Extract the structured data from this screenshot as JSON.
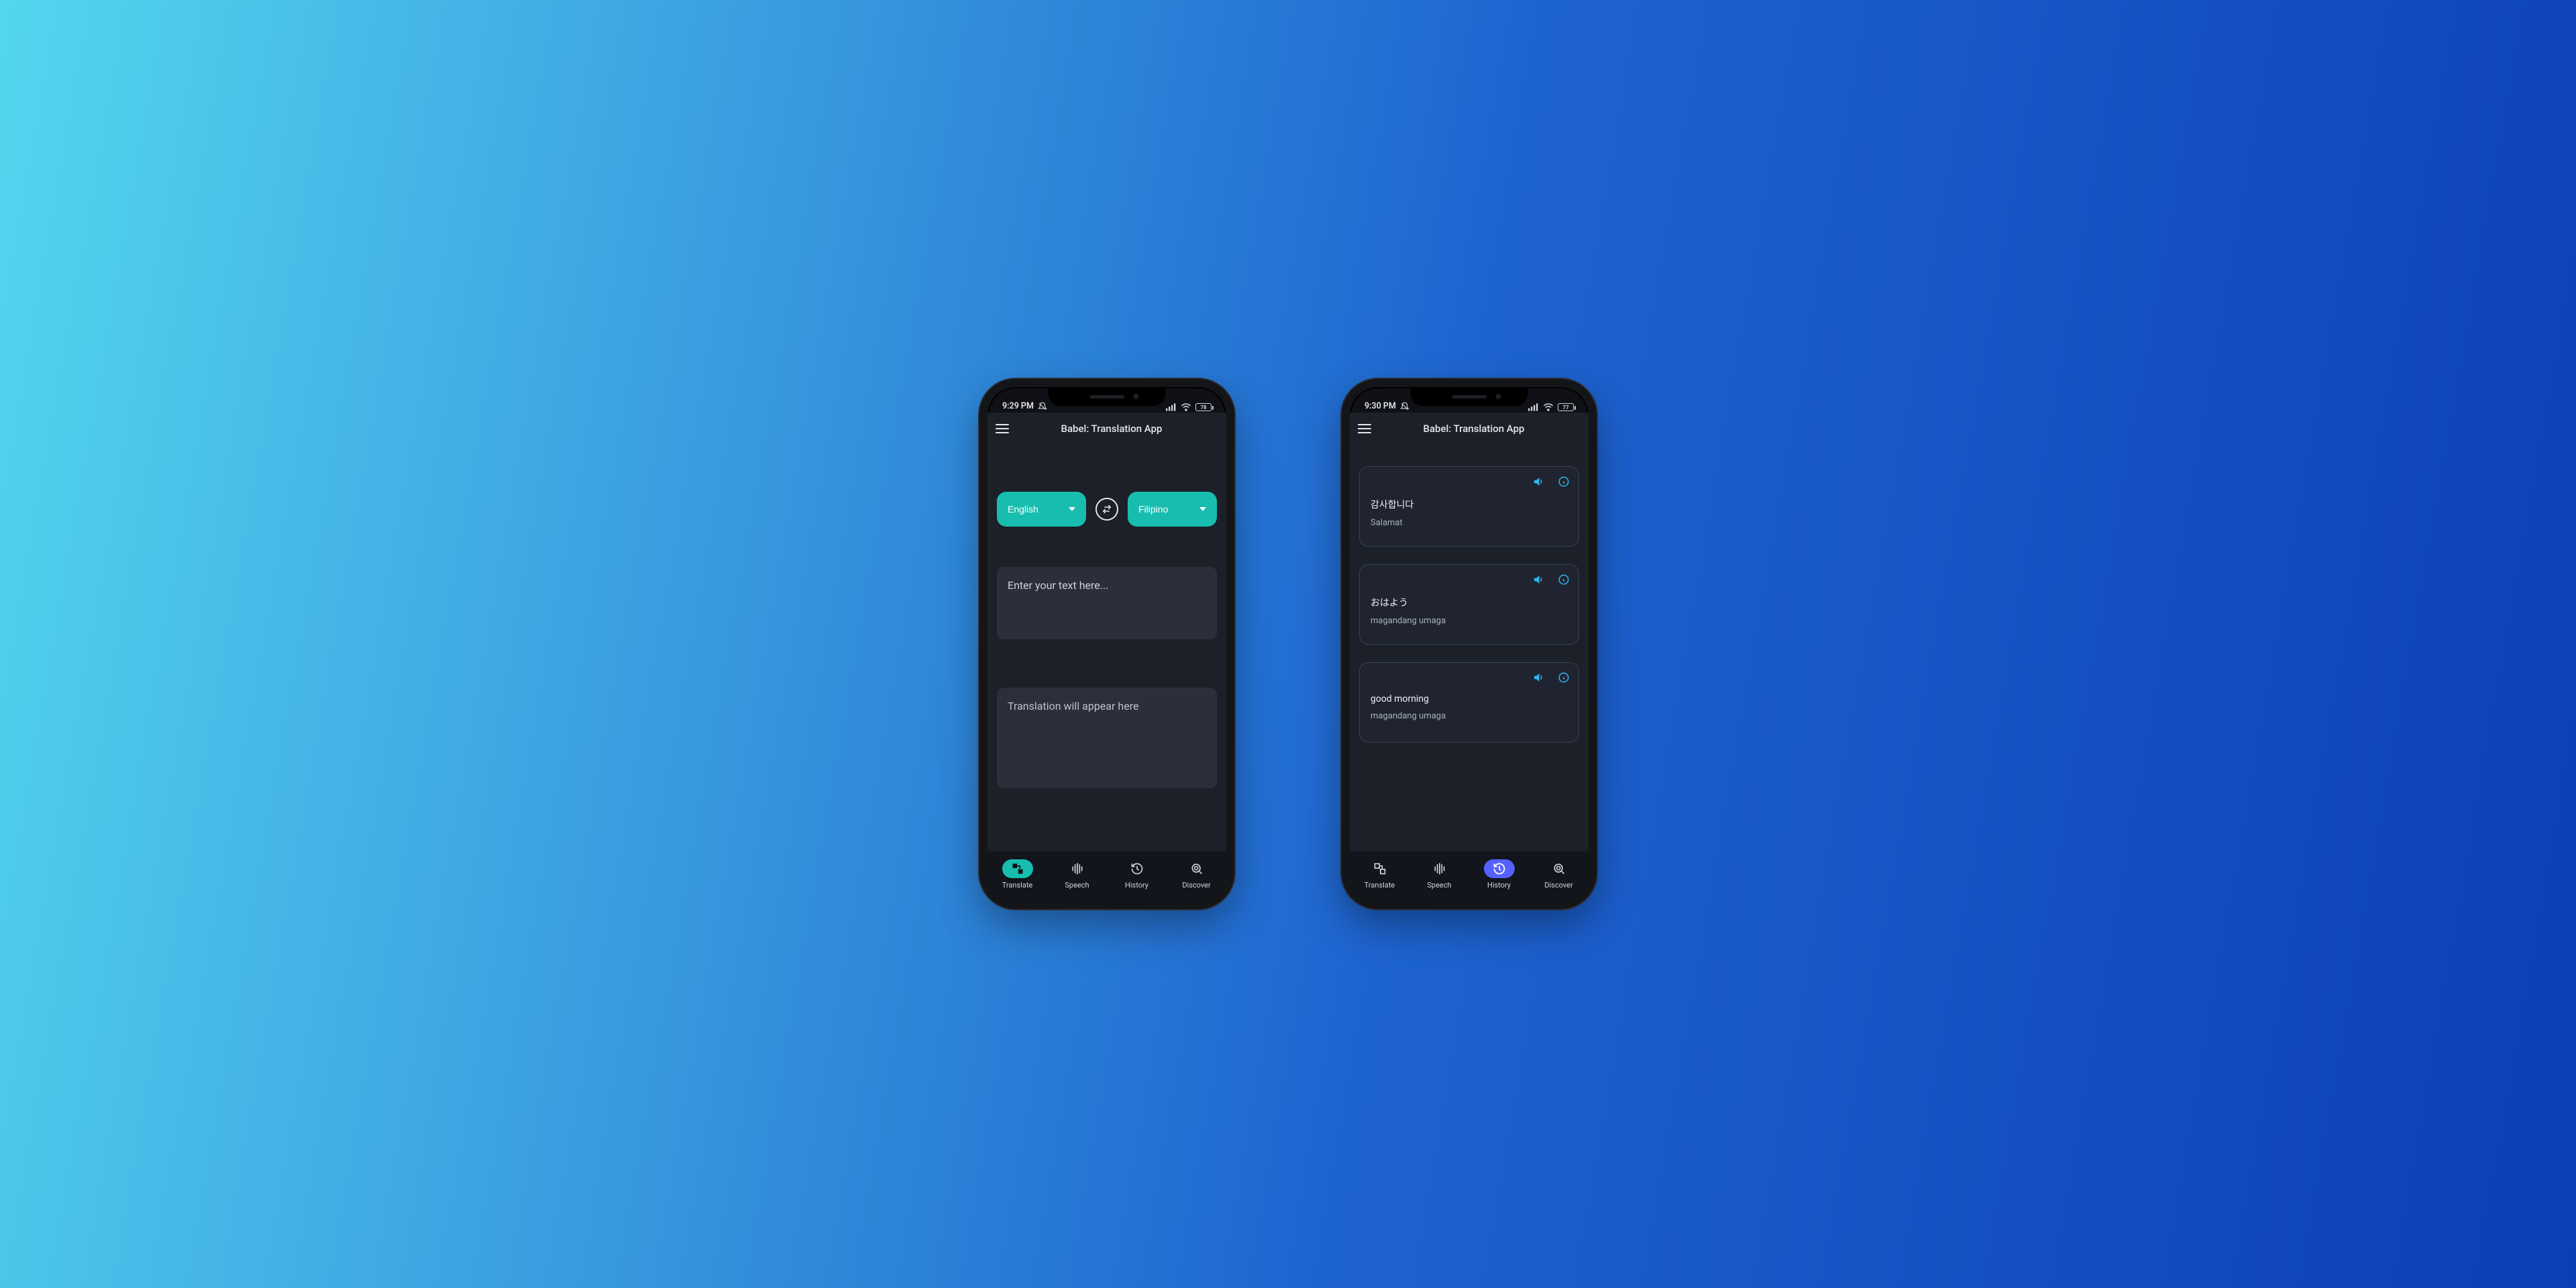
{
  "app_title": "Babel: Translation App",
  "phone1": {
    "status": {
      "time": "9:29 PM",
      "battery": "78"
    },
    "lang_from": "English",
    "lang_to": "Filipino",
    "input_placeholder": "Enter your text here...",
    "output_placeholder": "Translation will appear here",
    "tabs": {
      "translate": "Translate",
      "speech": "Speech",
      "history": "History",
      "discover": "Discover",
      "active": "translate"
    }
  },
  "phone2": {
    "status": {
      "time": "9:30 PM",
      "battery": "77"
    },
    "history": [
      {
        "source": "감사합니다",
        "target": "Salamat"
      },
      {
        "source": "おはよう",
        "target": "magandang umaga"
      },
      {
        "source": "good morning",
        "target": "magandang umaga"
      }
    ],
    "tabs": {
      "translate": "Translate",
      "speech": "Speech",
      "history": "History",
      "discover": "Discover",
      "active": "history"
    }
  },
  "icons": {
    "hamburger": "menu-icon",
    "swap": "swap-icon",
    "speaker": "speaker-icon",
    "info": "info-icon"
  },
  "colors": {
    "accent_teal": "#18bdb0",
    "accent_blue": "#5560ff",
    "link_blue": "#2fb6ef",
    "bg_dark": "#1c2029",
    "card": "#2a2f3a"
  }
}
